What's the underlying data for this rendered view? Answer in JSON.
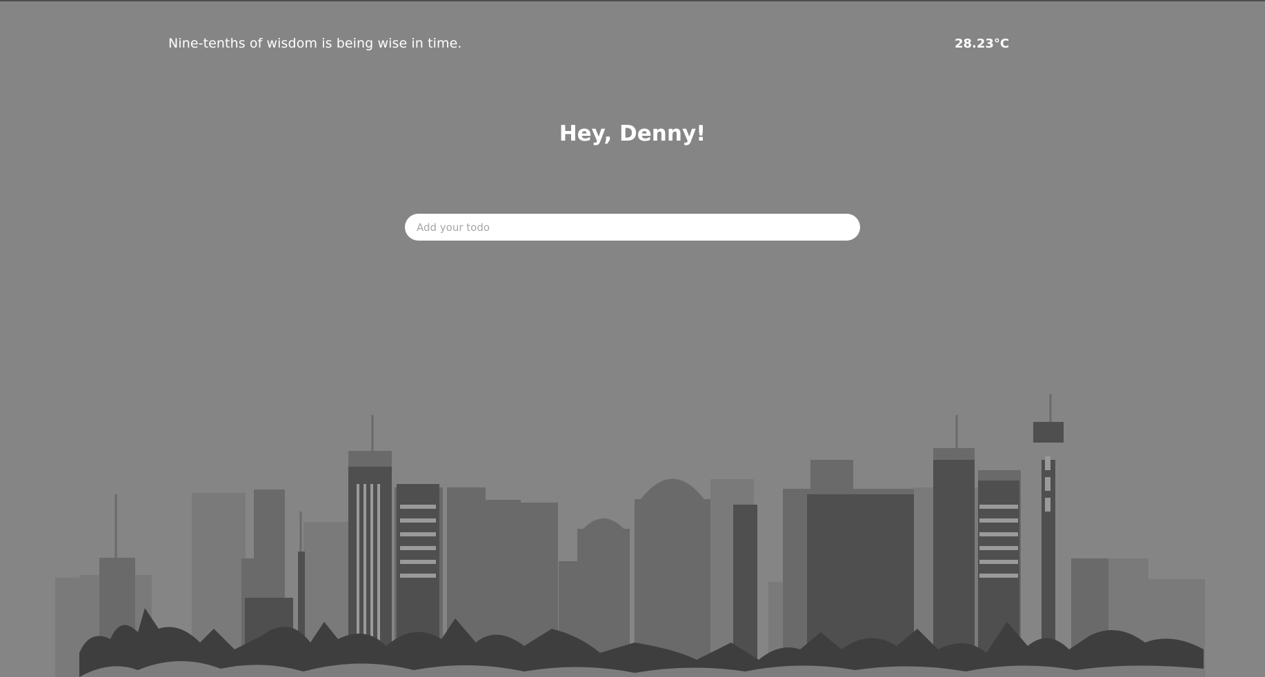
{
  "header": {
    "quote": "Nine-tenths of wisdom is being wise in time.",
    "temperature": "28.23°C"
  },
  "greeting": "Hey, Denny!",
  "todo": {
    "placeholder": "Add your todo",
    "value": ""
  },
  "background": {
    "color": "#858585",
    "image": "city-skyline-illustration"
  }
}
